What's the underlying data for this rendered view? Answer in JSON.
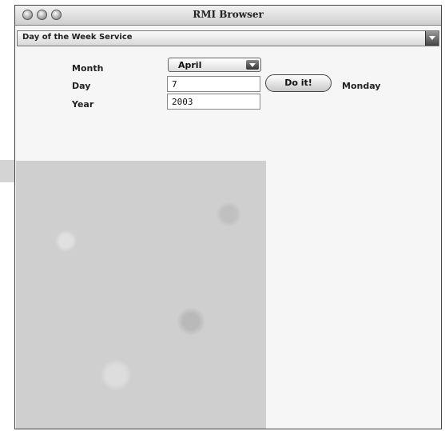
{
  "window": {
    "title": "RMI Browser"
  },
  "service_selector": {
    "selected": "Day of the Week Service"
  },
  "form": {
    "month_label": "Month",
    "month_value": "April",
    "day_label": "Day",
    "day_value": "7",
    "year_label": "Year",
    "year_value": "2003",
    "submit_label": "Do it!",
    "result": "Monday"
  },
  "icons": {
    "close": "close-icon",
    "minimize": "minimize-icon",
    "zoom": "zoom-icon",
    "dropdown": "chevron-down-icon"
  }
}
